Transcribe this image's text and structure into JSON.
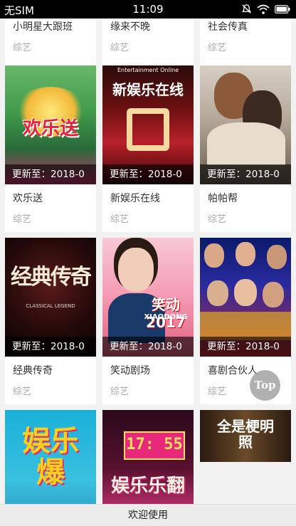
{
  "status_bar": {
    "carrier": "无SIM",
    "time": "11:09",
    "icons": [
      "mute-icon",
      "wifi-icon",
      "battery-icon"
    ]
  },
  "top_row": [
    {
      "title": "小明星大跟班",
      "category": "综艺"
    },
    {
      "title": "缘来不晚",
      "category": "综艺"
    },
    {
      "title": "社会传真",
      "category": "综艺"
    }
  ],
  "row2": [
    {
      "title": "欢乐送",
      "category": "综艺",
      "update": "更新至：2018-0",
      "poster_text": "欢乐送"
    },
    {
      "title": "新娱乐在线",
      "category": "综艺",
      "update": "更新至：2018-0",
      "poster_text": "新娱乐在线",
      "poster_subtext": "Entertainment Online"
    },
    {
      "title": "帕帕帮",
      "category": "综艺",
      "update": "更新至：2018-0"
    }
  ],
  "row3": [
    {
      "title": "经典传奇",
      "category": "综艺",
      "update": "更新至：2018-0",
      "poster_text": "经典传奇",
      "poster_subtext": "CLASSICAL LEGEND"
    },
    {
      "title": "笑动剧场",
      "category": "综艺",
      "update": "更新至：2018-0",
      "poster_text": "笑动2017",
      "poster_subtext": "XIAODONG"
    },
    {
      "title": "喜剧合伙人",
      "category": "综艺",
      "update": "更新至：2018-0"
    }
  ],
  "row4": [
    {
      "poster_text": "娱乐爆"
    },
    {
      "poster_text": "娱乐乐翻",
      "poster_subtext": "17: 55"
    },
    {
      "poster_text": "全是梗明照"
    }
  ],
  "top_button": "Top",
  "bottom_bar": "欢迎使用"
}
